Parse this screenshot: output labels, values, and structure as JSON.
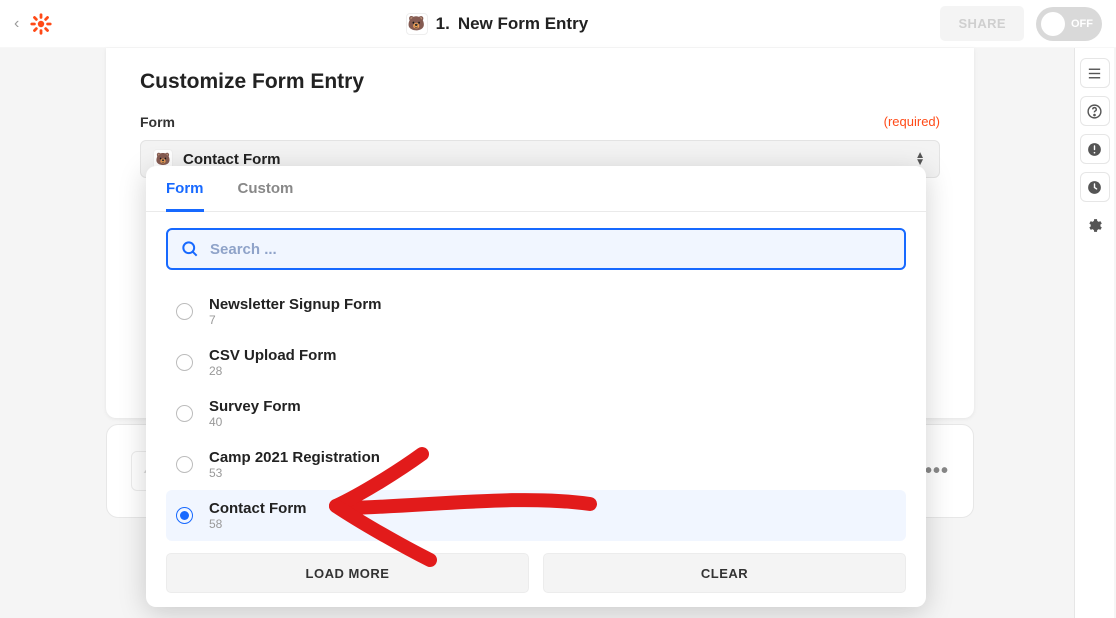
{
  "header": {
    "title_prefix": "1.",
    "title": "New Form Entry",
    "share_label": "SHARE",
    "toggle_label": "OFF"
  },
  "panel": {
    "heading": "Customize Form Entry",
    "field_label": "Form",
    "required_text": "(required)",
    "selected_value": "Contact Form"
  },
  "dropdown": {
    "tabs": {
      "form": "Form",
      "custom": "Custom"
    },
    "search_placeholder": "Search ...",
    "options": [
      {
        "label": "Newsletter Signup Form",
        "id": "7",
        "selected": false
      },
      {
        "label": "CSV Upload Form",
        "id": "28",
        "selected": false
      },
      {
        "label": "Survey Form",
        "id": "40",
        "selected": false
      },
      {
        "label": "Camp 2021 Registration",
        "id": "53",
        "selected": false
      },
      {
        "label": "Contact Form",
        "id": "58",
        "selected": true
      }
    ],
    "load_more_label": "LOAD MORE",
    "clear_label": "CLEAR"
  },
  "icons": {
    "wpforms_emoji": "🐻",
    "help_glyph": "?",
    "more_glyph": "•••"
  },
  "annotation": {
    "color": "#e21b1b"
  }
}
